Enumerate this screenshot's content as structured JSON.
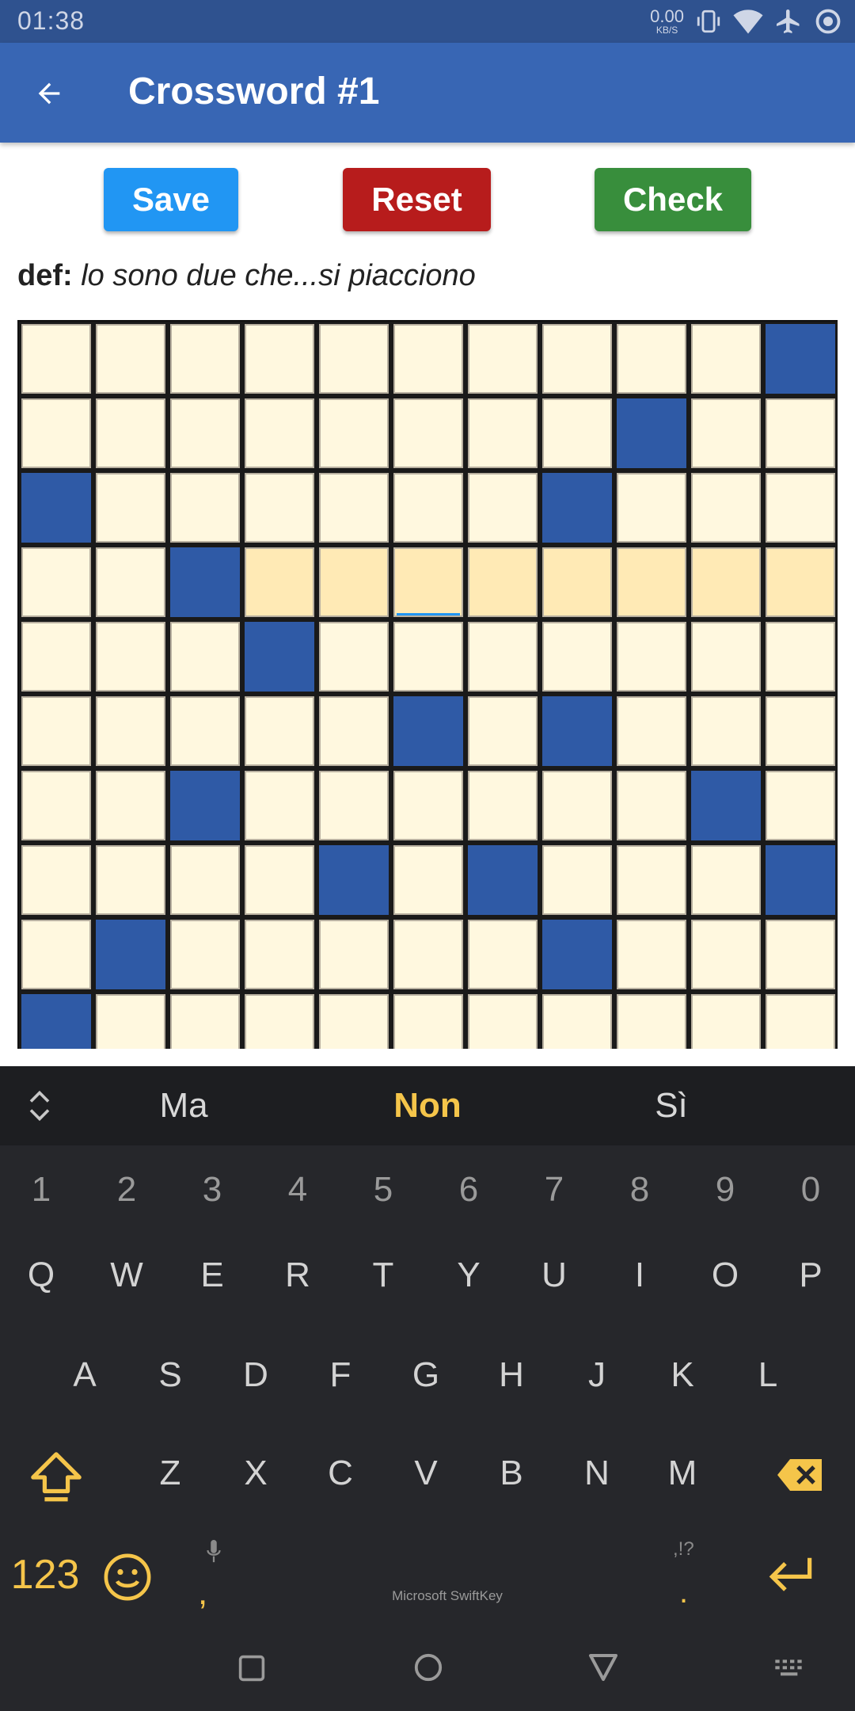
{
  "status_bar": {
    "time": "01:38",
    "net_speed_value": "0.00",
    "net_speed_unit": "KB/S",
    "icons": [
      "vibrate-icon",
      "wifi-icon",
      "airplane-mode-icon",
      "sync-icon"
    ]
  },
  "app_bar": {
    "title": "Crossword #1",
    "back_icon": "arrow-left-icon"
  },
  "actions": {
    "save_label": "Save",
    "reset_label": "Reset",
    "check_label": "Check"
  },
  "definition": {
    "label": "def:",
    "text": "lo sono due che...si piacciono"
  },
  "crossword": {
    "columns": 11,
    "visible_rows": 10,
    "colors": {
      "empty": "#fff8df",
      "black": "#2f5aa6",
      "highlight": "#ffeab5",
      "cursor": "#2196f3"
    },
    "black_cells": [
      [
        0,
        10
      ],
      [
        1,
        8
      ],
      [
        2,
        0
      ],
      [
        2,
        7
      ],
      [
        3,
        2
      ],
      [
        4,
        3
      ],
      [
        5,
        5
      ],
      [
        5,
        7
      ],
      [
        6,
        2
      ],
      [
        6,
        9
      ],
      [
        7,
        4
      ],
      [
        7,
        6
      ],
      [
        7,
        10
      ],
      [
        8,
        1
      ],
      [
        8,
        7
      ],
      [
        9,
        0
      ]
    ],
    "highlighted_cells": [
      [
        3,
        3
      ],
      [
        3,
        4
      ],
      [
        3,
        5
      ],
      [
        3,
        6
      ],
      [
        3,
        7
      ],
      [
        3,
        8
      ],
      [
        3,
        9
      ],
      [
        3,
        10
      ]
    ],
    "focused_cell": [
      3,
      5
    ]
  },
  "keyboard": {
    "suggestions": [
      "Ma",
      "Non",
      "Sì"
    ],
    "number_row": [
      "1",
      "2",
      "3",
      "4",
      "5",
      "6",
      "7",
      "8",
      "9",
      "0"
    ],
    "row1": [
      "Q",
      "W",
      "E",
      "R",
      "T",
      "Y",
      "U",
      "I",
      "O",
      "P"
    ],
    "row2": [
      "A",
      "S",
      "D",
      "F",
      "G",
      "H",
      "J",
      "K",
      "L"
    ],
    "row3": [
      "Z",
      "X",
      "C",
      "V",
      "B",
      "N",
      "M"
    ],
    "numbers_toggle": "123",
    "comma": ",",
    "punctuation_hint": ",!?",
    "period": ".",
    "brand": "Microsoft SwiftKey",
    "accent_color": "#f5c54a"
  },
  "nav_bar": {
    "icons": [
      "recent-apps-icon",
      "home-icon",
      "back-nav-icon",
      "keyboard-toggle-icon"
    ]
  }
}
